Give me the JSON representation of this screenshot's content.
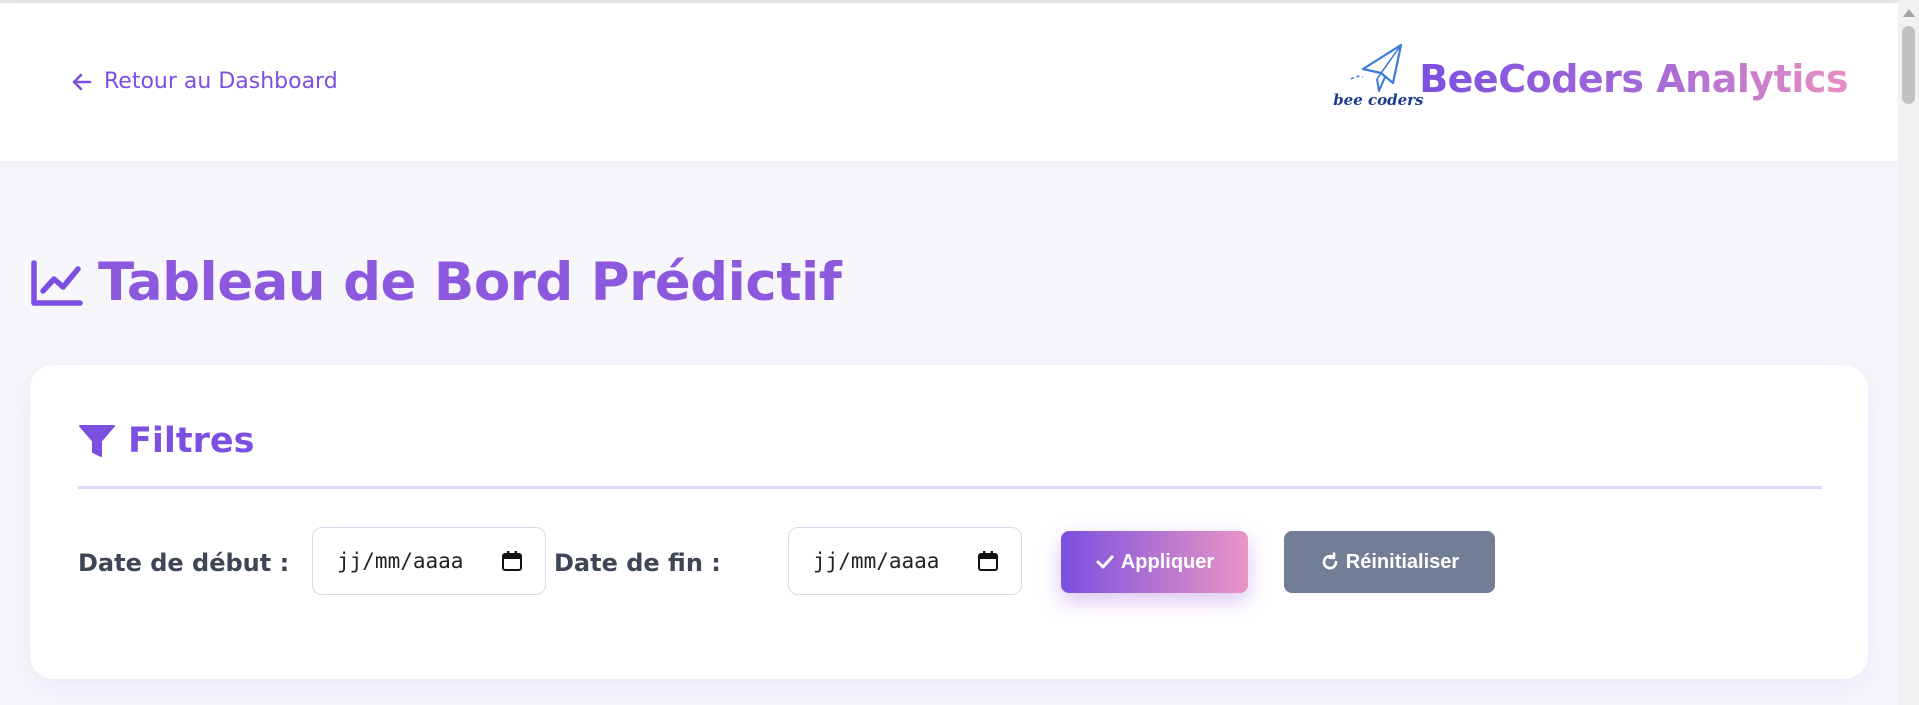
{
  "header": {
    "back_link_label": "Retour au Dashboard",
    "brand_name": "BeeCoders Analytics",
    "logo_text": "bee coders"
  },
  "page": {
    "title": "Tableau de Bord Prédictif"
  },
  "filters": {
    "title": "Filtres",
    "start_date_label": "Date de début :",
    "start_date_placeholder": "jj/mm/aaaa",
    "end_date_label": "Date de fin :",
    "end_date_placeholder": "jj/mm/aaaa",
    "apply_button_label": "Appliquer",
    "reset_button_label": "Réinitialiser"
  },
  "icons": {
    "back": "arrow-left-icon",
    "title": "chart-line-icon",
    "filters": "filter-icon",
    "calendar": "calendar-icon",
    "apply": "check-icon",
    "reset": "refresh-icon",
    "logo": "paper-plane-icon"
  },
  "colors": {
    "accent": "#7b4fe0",
    "title": "#8b58de",
    "gradient_end": "#e996c4",
    "reset_button": "#717e95",
    "background": "#f7f7fb"
  }
}
